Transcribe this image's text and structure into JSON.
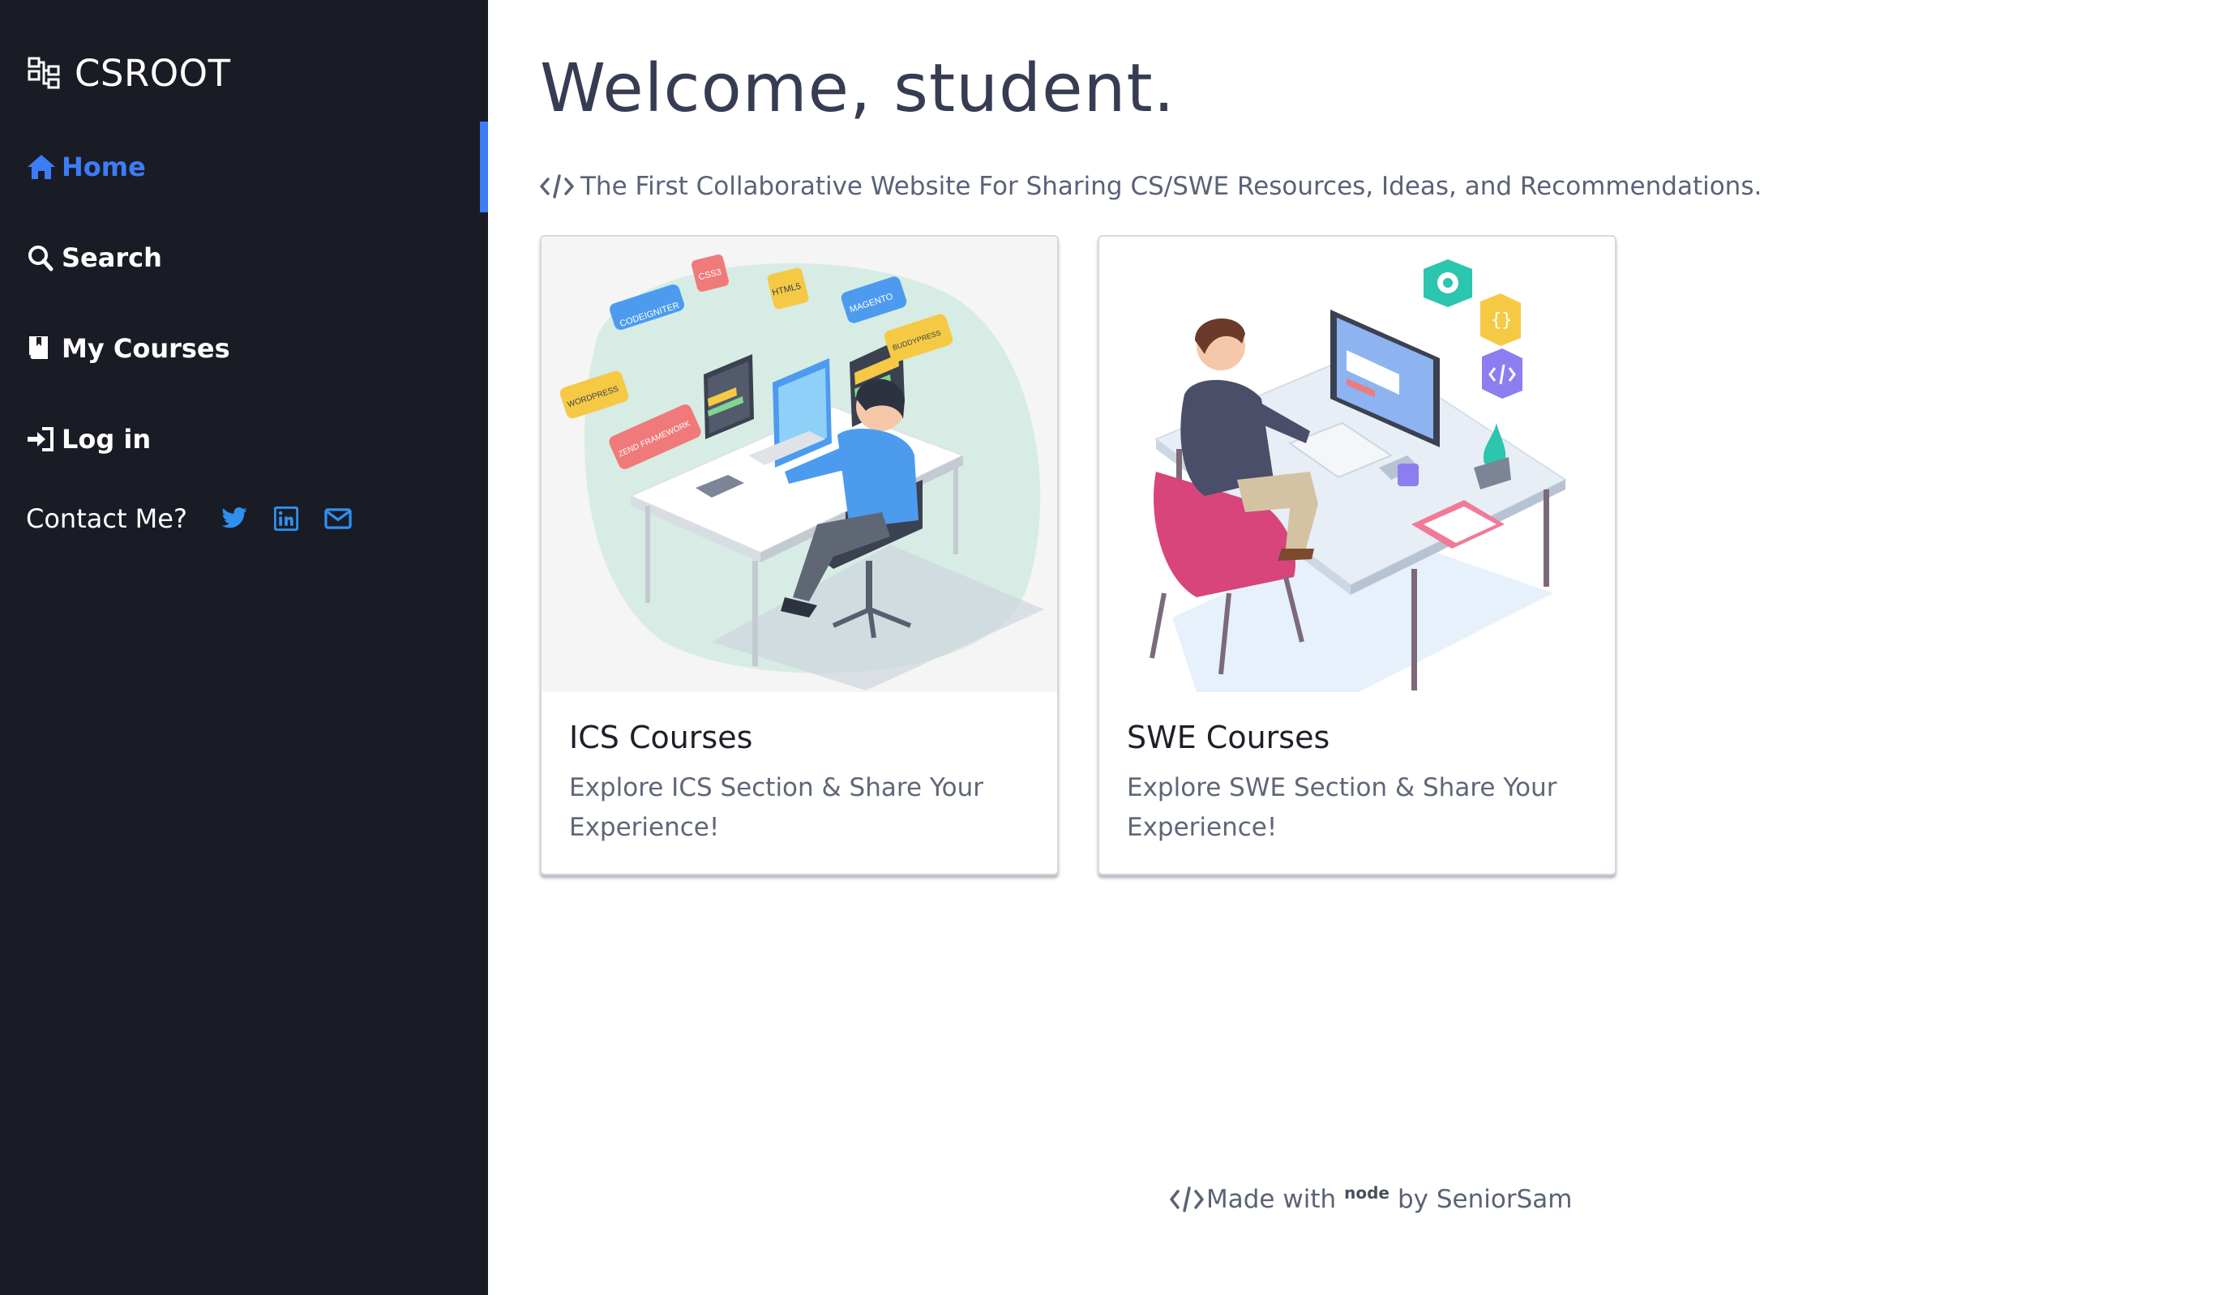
{
  "sidebar": {
    "brand": "CSROOT",
    "nav": {
      "home": "Home",
      "search": "Search",
      "my_courses": "My Courses",
      "login": "Log in"
    },
    "contact_label": "Contact Me?",
    "social_icons": [
      "twitter-icon",
      "linkedin-icon",
      "envelope-icon"
    ]
  },
  "main": {
    "title": "Welcome, student.",
    "tagline": "The First Collaborative Website For Sharing CS/SWE Resources, Ideas, and Recommendations.",
    "cards": [
      {
        "title": "ICS Courses",
        "text": "Explore ICS Section & Share Your Experience!",
        "illustration_labels": [
          "CODEIGNITER",
          "CSS3",
          "HTML5",
          "MAGENTO",
          "BUDDYPRESS",
          "WORDPRESS",
          "ZEND FRAMEWORK"
        ]
      },
      {
        "title": "SWE Courses",
        "text": "Explore SWE Section & Share Your Experience!"
      }
    ]
  },
  "footer": {
    "made_with": "Made with",
    "node_logo": "node",
    "by": "by SeniorSam"
  },
  "colors": {
    "sidebar_bg": "#1a1c25",
    "accent": "#3d7cf7",
    "social_icon": "#2f8ff0",
    "heading": "#363c52"
  }
}
